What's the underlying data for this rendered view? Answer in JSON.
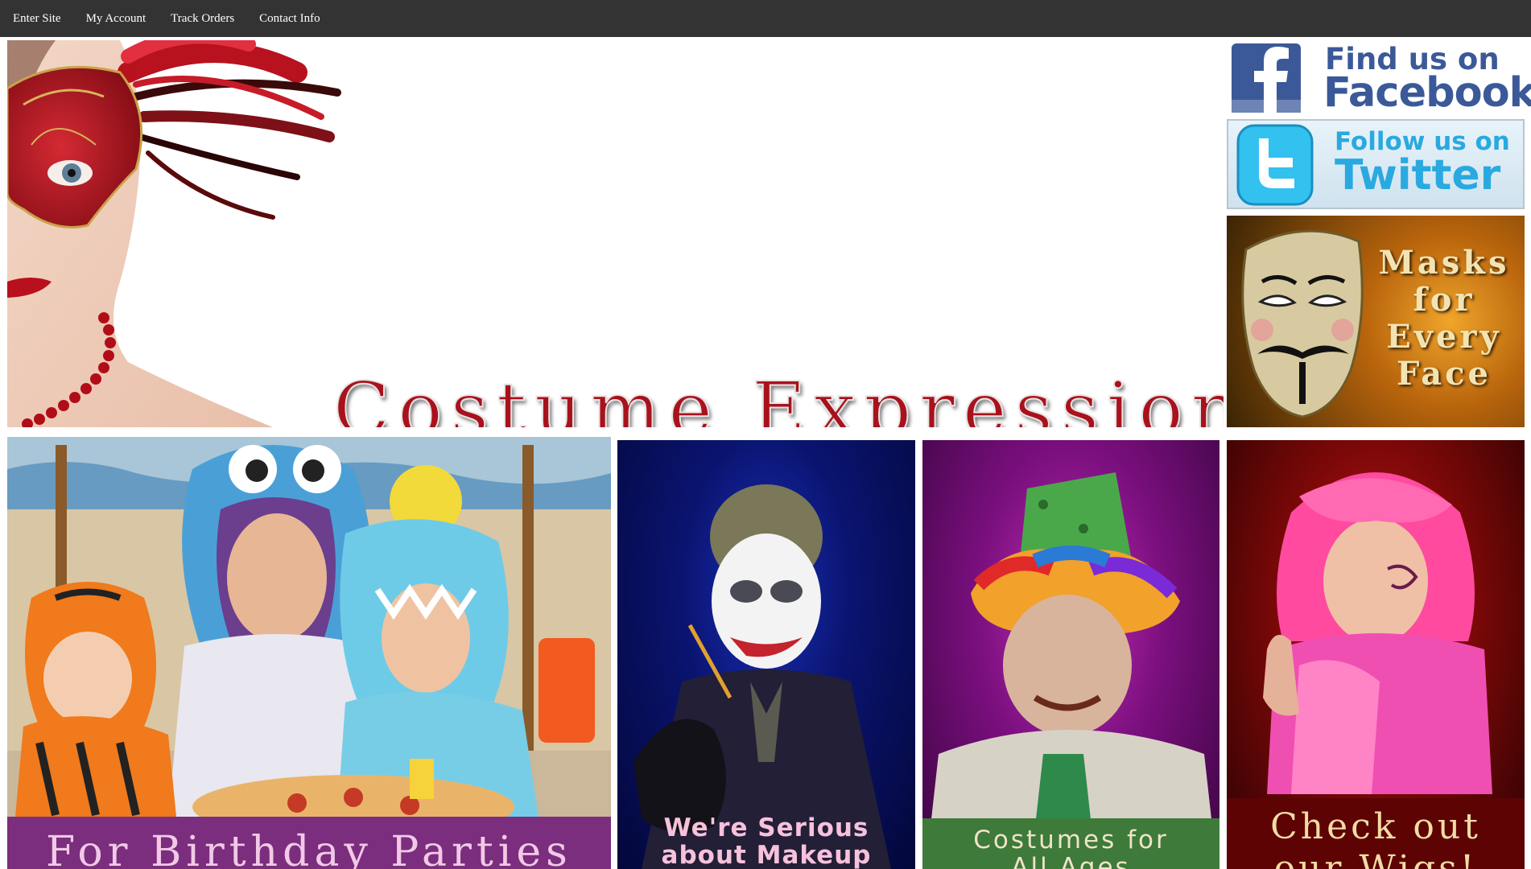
{
  "nav": {
    "items": [
      {
        "label": "Enter Site"
      },
      {
        "label": "My Account"
      },
      {
        "label": "Track Orders"
      },
      {
        "label": "Contact Info"
      }
    ],
    "bg_color": "#333333"
  },
  "hero": {
    "title": "Costume Expressions",
    "title_color": "#a8121d",
    "image": "masquerade-woman-red-feather-mask"
  },
  "social": {
    "facebook": {
      "line1": "Find us on",
      "line2": "Facebook",
      "icon": "facebook-icon"
    },
    "twitter": {
      "line1": "Follow us on",
      "line2": "Twitter",
      "icon": "twitter-icon"
    }
  },
  "promo_masks": {
    "lines": [
      "Masks",
      "for",
      "Every",
      "Face"
    ]
  },
  "tiles": [
    {
      "caption": "For Birthday Parties",
      "strip_color": "#7b2d7e"
    },
    {
      "caption_lines": [
        "We're Serious",
        "about Makeup"
      ],
      "text_color": "#f7c1dc"
    },
    {
      "caption_lines": [
        "Costumes for",
        "All Ages"
      ],
      "strip_color": "#3e7a3a"
    },
    {
      "caption_lines": [
        "Check out",
        "our Wigs!"
      ],
      "strip_color": "#5d0303"
    }
  ]
}
